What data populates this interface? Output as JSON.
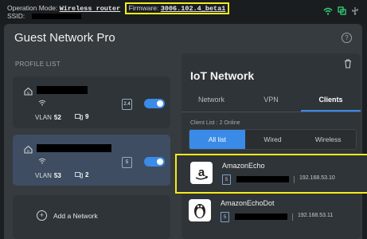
{
  "topbar": {
    "operation_mode_label": "Operation Mode:",
    "operation_mode_value": "Wireless router",
    "firmware_label": "Firmware:",
    "firmware_value": "3006.102.4_beta1",
    "ssid_label": "SSID:"
  },
  "page": {
    "title": "Guest Network Pro",
    "help_glyph": "?"
  },
  "profile_list": {
    "heading": "PROFILE LIST",
    "profiles": [
      {
        "band": "2.4",
        "vlan_label": "VLAN",
        "vlan": "52",
        "device_count": "9",
        "enabled": true
      },
      {
        "band": "5",
        "vlan_label": "VLAN",
        "vlan": "53",
        "device_count": "2",
        "enabled": true
      }
    ],
    "add_label": "Add a Network"
  },
  "network_detail": {
    "title": "IoT Network",
    "tabs": [
      "Network",
      "VPN",
      "Clients"
    ],
    "active_tab": "Clients",
    "client_count_text": "Client List : 2 Online",
    "filters": [
      "All list",
      "Wired",
      "Wireless"
    ],
    "active_filter": "All list",
    "clients": [
      {
        "name": "AmazonEcho",
        "band": "5",
        "ip": "192.168.53.10",
        "icon": "amazon-logo-icon"
      },
      {
        "name": "AmazonEchoDot",
        "band": "5",
        "ip": "192.168.53.11",
        "icon": "linux-penguin-icon"
      }
    ]
  },
  "colors": {
    "accent": "#3a8be8",
    "highlight": "#f5ec1a",
    "panel": "#363b3f"
  }
}
